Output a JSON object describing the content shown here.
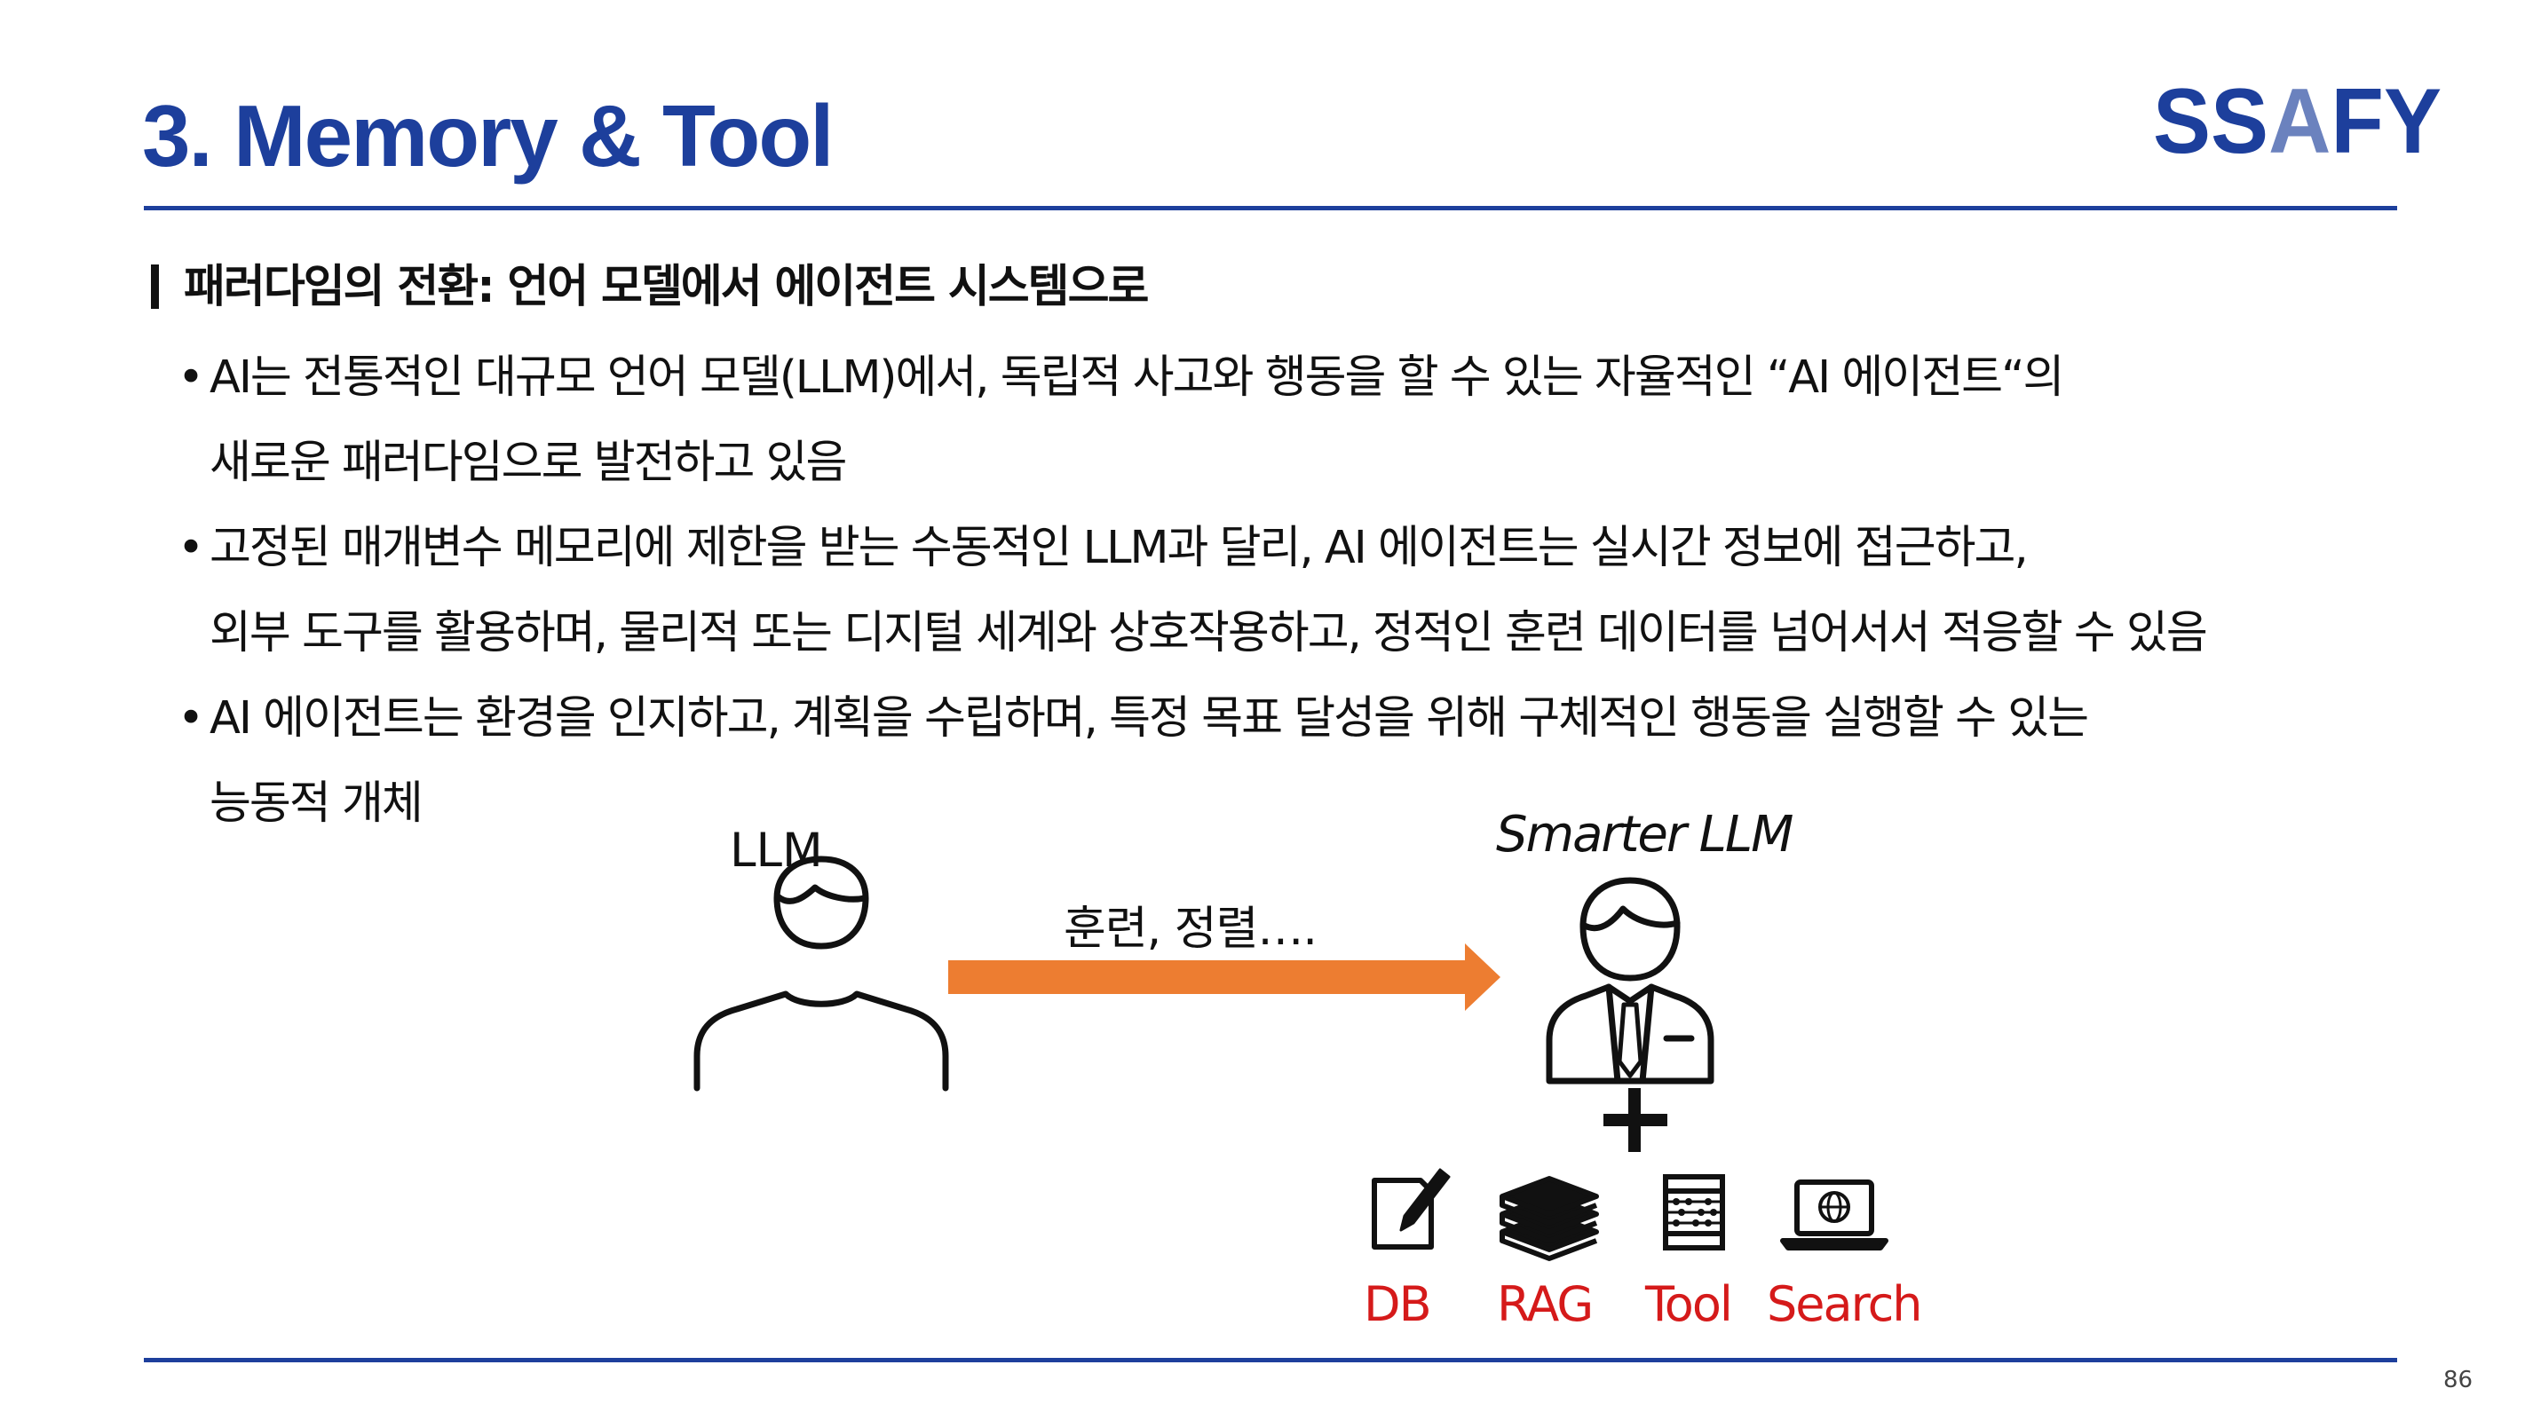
{
  "header": {
    "title": "3. Memory & Tool",
    "logo_text": "SSAFY",
    "brand_color": "#1d3f9c"
  },
  "section": {
    "heading": "패러다임의 전환: 언어 모델에서 에이전트 시스템으로",
    "bullets": [
      {
        "lines": [
          "AI는 전통적인 대규모 언어 모델(LLM)에서, 독립적 사고와 행동을 할 수 있는 자율적인 “AI 에이전트“의",
          "새로운 패러다임으로 발전하고 있음"
        ]
      },
      {
        "lines": [
          "고정된 매개변수 메모리에 제한을 받는 수동적인 LLM과 달리, AI 에이전트는 실시간 정보에 접근하고,",
          "외부 도구를 활용하며, 물리적 또는 디지털 세계와 상호작용하고, 정적인 훈련 데이터를 넘어서서 적응할 수 있음"
        ]
      },
      {
        "lines": [
          "AI 에이전트는 환경을 인지하고, 계획을 수립하며, 특정 목표 달성을 위해 구체적인 행동을 실행할 수 있는",
          "능동적 개체"
        ]
      }
    ]
  },
  "diagram": {
    "llm_label": "LLM",
    "smarter_label": "Smarter LLM",
    "arrow_label": "훈련, 정렬….",
    "arrow_color": "#ed7d31",
    "tool_color": "#d51a1a",
    "tools": [
      {
        "label": "DB",
        "icon": "document-pencil-icon"
      },
      {
        "label": "RAG",
        "icon": "books-stack-icon"
      },
      {
        "label": "Tool",
        "icon": "abacus-icon"
      },
      {
        "label": "Search",
        "icon": "laptop-globe-icon"
      }
    ]
  },
  "footer": {
    "page_number": "86"
  }
}
